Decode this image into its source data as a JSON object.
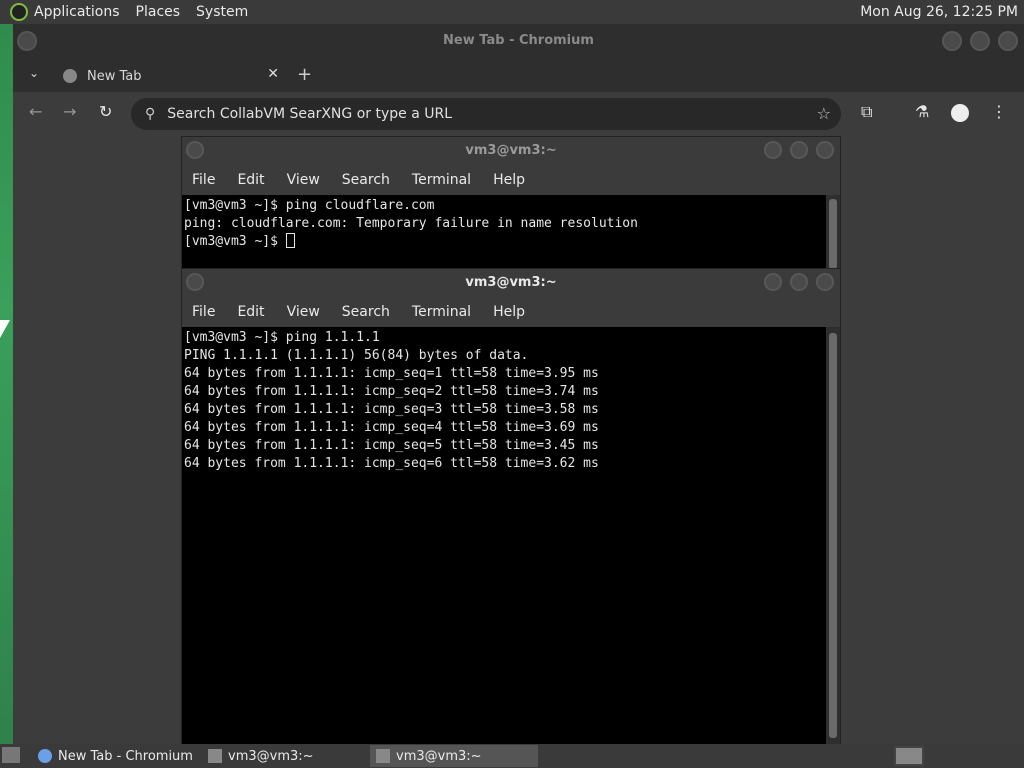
{
  "top_panel": {
    "menus": [
      "Applications",
      "Places",
      "System"
    ],
    "clock": "Mon Aug 26, 12:25 PM"
  },
  "browser": {
    "window_title": "New Tab - Chromium",
    "tab_title": "New Tab",
    "omnibox_placeholder": "Search CollabVM SearXNG or type a URL"
  },
  "terminal_back": {
    "title": "vm3@vm3:~",
    "menu": [
      "File",
      "Edit",
      "View",
      "Search",
      "Terminal",
      "Help"
    ],
    "lines": [
      "[vm3@vm3 ~]$ ping cloudflare.com",
      "ping: cloudflare.com: Temporary failure in name resolution",
      "[vm3@vm3 ~]$ "
    ]
  },
  "terminal_front": {
    "title": "vm3@vm3:~",
    "menu": [
      "File",
      "Edit",
      "View",
      "Search",
      "Terminal",
      "Help"
    ],
    "lines": [
      "[vm3@vm3 ~]$ ping 1.1.1.1",
      "PING 1.1.1.1 (1.1.1.1) 56(84) bytes of data.",
      "64 bytes from 1.1.1.1: icmp_seq=1 ttl=58 time=3.95 ms",
      "64 bytes from 1.1.1.1: icmp_seq=2 ttl=58 time=3.74 ms",
      "64 bytes from 1.1.1.1: icmp_seq=3 ttl=58 time=3.58 ms",
      "64 bytes from 1.1.1.1: icmp_seq=4 ttl=58 time=3.69 ms",
      "64 bytes from 1.1.1.1: icmp_seq=5 ttl=58 time=3.45 ms",
      "64 bytes from 1.1.1.1: icmp_seq=6 ttl=58 time=3.62 ms"
    ]
  },
  "taskbar": {
    "items": [
      {
        "label": "New Tab - Chromium",
        "active": false
      },
      {
        "label": "vm3@vm3:~",
        "active": false
      },
      {
        "label": "vm3@vm3:~",
        "active": true
      }
    ]
  }
}
